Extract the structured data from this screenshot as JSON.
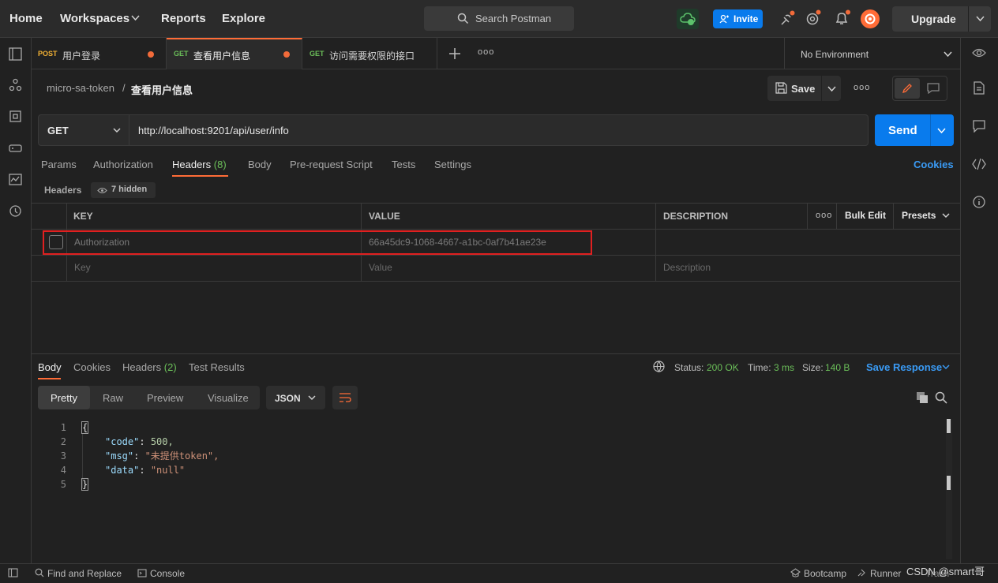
{
  "topbar": {
    "home": "Home",
    "workspaces": "Workspaces",
    "reports": "Reports",
    "explore": "Explore",
    "search_placeholder": "Search Postman",
    "invite": "Invite",
    "upgrade": "Upgrade"
  },
  "tabs": [
    {
      "method": "POST",
      "title": "用户登录"
    },
    {
      "method": "GET",
      "title": "查看用户信息"
    },
    {
      "method": "GET",
      "title": "访问需要权限的接口"
    }
  ],
  "environment": "No Environment",
  "breadcrumb": {
    "collection": "micro-sa-token",
    "separator": "/",
    "request": "查看用户信息"
  },
  "save_label": "Save",
  "request": {
    "method": "GET",
    "url": "http://localhost:9201/api/user/info",
    "send": "Send"
  },
  "req_tabs": {
    "params": "Params",
    "authorization": "Authorization",
    "headers": "Headers",
    "headers_count": "(8)",
    "body": "Body",
    "prerequest": "Pre-request Script",
    "tests": "Tests",
    "settings": "Settings",
    "cookies": "Cookies"
  },
  "headers_section": {
    "label": "Headers",
    "hidden": "7 hidden"
  },
  "table": {
    "key": "KEY",
    "value": "VALUE",
    "description": "DESCRIPTION",
    "more": "ooo",
    "bulk_edit": "Bulk Edit",
    "presets": "Presets",
    "row": {
      "key": "Authorization",
      "value": "66a45dc9-1068-4667-a1bc-0af7b41ae23e"
    },
    "placeholder": {
      "key": "Key",
      "value": "Value",
      "description": "Description"
    }
  },
  "response": {
    "body": "Body",
    "cookies": "Cookies",
    "headers": "Headers",
    "headers_count": "(2)",
    "test_results": "Test Results",
    "status_label": "Status:",
    "status_value": "200 OK",
    "time_label": "Time:",
    "time_value": "3 ms",
    "size_label": "Size:",
    "size_value": "140 B",
    "save_response": "Save Response",
    "views": {
      "pretty": "Pretty",
      "raw": "Raw",
      "preview": "Preview",
      "visualize": "Visualize"
    },
    "format": "JSON"
  },
  "code_lines": [
    {
      "n": "1",
      "k": "",
      "v": "{"
    },
    {
      "n": "2",
      "k": "\"code\"",
      "v": "500,"
    },
    {
      "n": "3",
      "k": "\"msg\"",
      "v": "\"未提供token\","
    },
    {
      "n": "4",
      "k": "\"data\"",
      "v": "\"null\""
    },
    {
      "n": "5",
      "k": "",
      "v": "}"
    }
  ],
  "footer": {
    "find_replace": "Find and Replace",
    "console": "Console",
    "bootcamp": "Bootcamp",
    "runner": "Runner",
    "trash": "Trash",
    "watermark": "CSDN @smart哥"
  },
  "colors": {
    "accent": "#ff6c37",
    "blue": "#097bed",
    "green": "#6bbf59",
    "highlight": "#e02020"
  }
}
